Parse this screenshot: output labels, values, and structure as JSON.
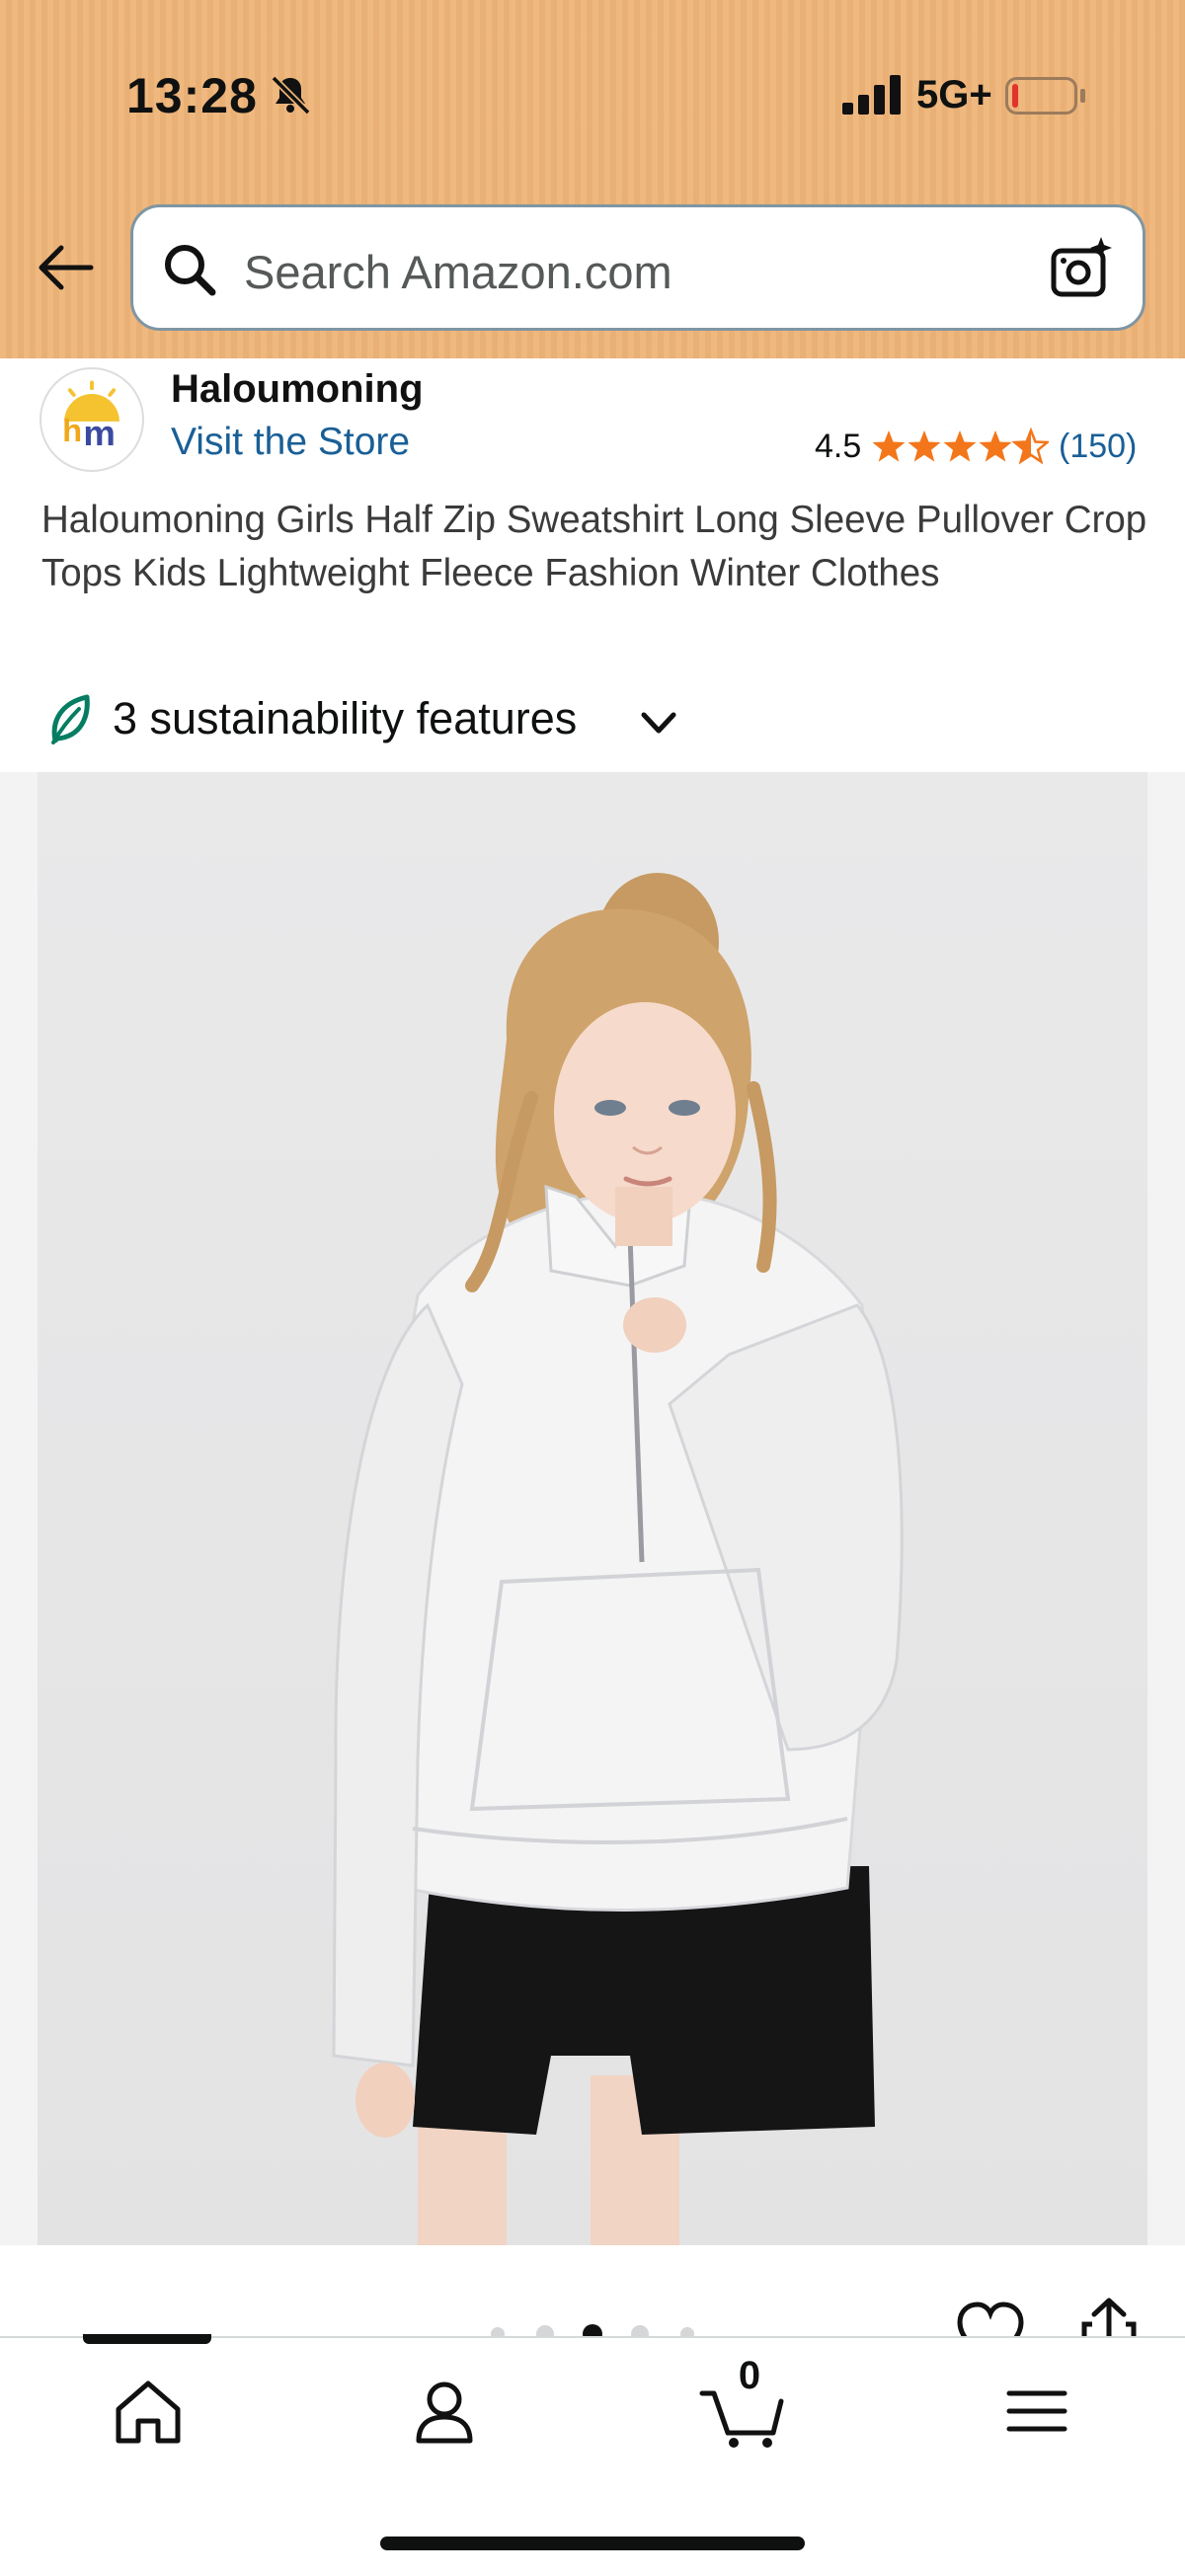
{
  "status_bar": {
    "time": "13:28",
    "network": "5G+",
    "icons": [
      "bell-slash-icon",
      "signal-icon",
      "battery-low-icon"
    ],
    "battery_color": "#e0332c"
  },
  "header": {
    "background": "#eeb478",
    "back_icon": "arrow-left-icon",
    "search": {
      "placeholder": "Search Amazon.com",
      "icon": "search-icon",
      "camera_icon": "camera-sparkle-icon"
    }
  },
  "brand": {
    "logo_text": "hm",
    "name": "Haloumoning",
    "store_link": "Visit the Store"
  },
  "rating": {
    "value": "4.5",
    "stars": 4.5,
    "stars_max": 5,
    "count": "(150)",
    "star_color": "#f3761a"
  },
  "product": {
    "title": "Haloumoning Girls Half Zip Sweatshirt Long Sleeve Pullover Crop Tops Kids Lightweight Fleece Fashion Winter Clothes"
  },
  "sustainability": {
    "label": "3 sustainability features",
    "icon": "leaf-icon",
    "color": "#067d62"
  },
  "carousel": {
    "total_dots": 5,
    "active_index": 2
  },
  "actions": [
    "heart-icon",
    "share-icon"
  ],
  "bottom_nav": {
    "items": [
      "home-icon",
      "account-icon",
      "cart-icon",
      "menu-icon"
    ],
    "cart_count": "0",
    "active_index": 0
  }
}
